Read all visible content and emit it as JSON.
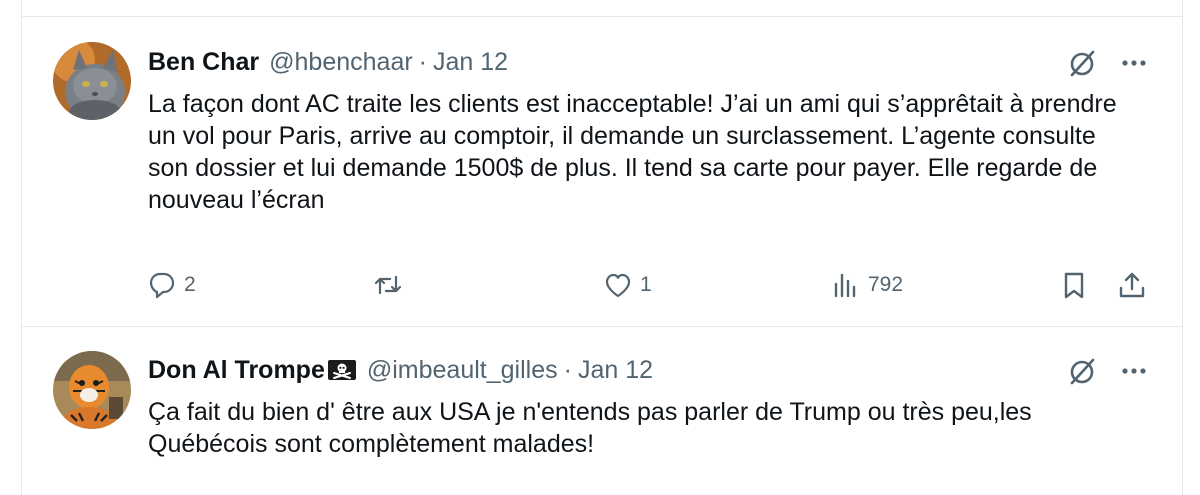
{
  "tweets": [
    {
      "name": "Ben Char",
      "handle": "@hbenchaar",
      "separator": "·",
      "date": "Jan 12",
      "text": "La façon dont AC traite les clients est inacceptable! J’ai un ami qui s’apprêtait à prendre un vol pour Paris, arrive au comptoir, il demande un surclassement. L’agente consulte son dossier et lui demande 1500$ de plus. Il tend sa carte pour payer. Elle regarde de nouveau l’écran",
      "replies": "2",
      "retweets": "",
      "likes": "1",
      "views": "792",
      "avatar": "cat-photo"
    },
    {
      "name": "Don Al Trompe",
      "name_badge": "pirate-flag-emoji",
      "handle": "@imbeault_gilles",
      "separator": "·",
      "date": "Jan 12",
      "text": "Ça fait du bien d' être aux USA je n'entends pas parler de Trump ou très peu,les Québécois sont complètement malades!",
      "avatar": "tiger-costume-photo"
    }
  ],
  "icons": {
    "grok": "grok-icon",
    "more": "more-icon",
    "reply": "reply-icon",
    "retweet": "retweet-icon",
    "like": "heart-icon",
    "views": "views-icon",
    "bookmark": "bookmark-icon",
    "share": "share-icon"
  },
  "colors": {
    "text": "#0f1419",
    "secondary": "#536471",
    "divider": "#e7e9ea"
  }
}
